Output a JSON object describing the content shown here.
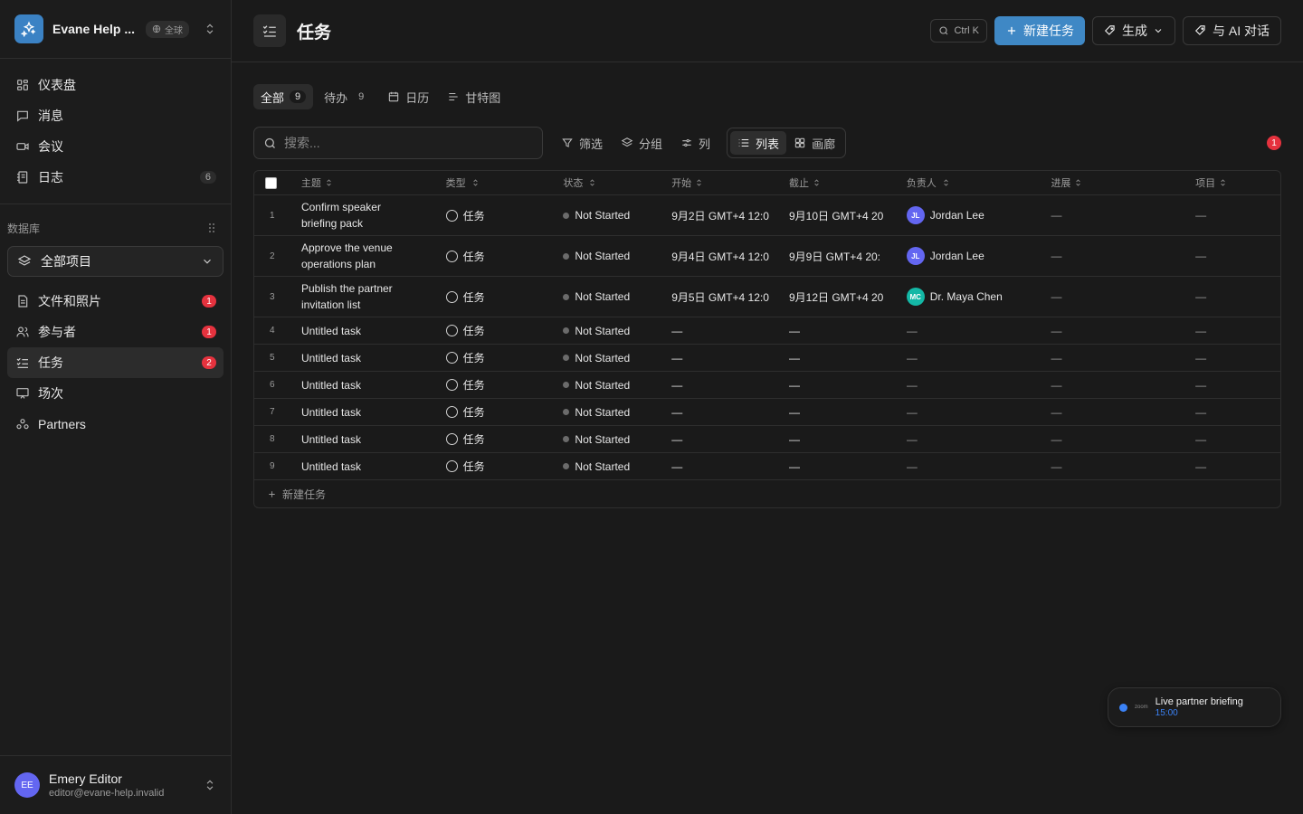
{
  "workspace": {
    "name": "Evane Help ...",
    "scope": "全球"
  },
  "nav": [
    {
      "id": "dashboard",
      "label": "仪表盘",
      "icon": "grid-icon"
    },
    {
      "id": "messages",
      "label": "消息",
      "icon": "message-icon"
    },
    {
      "id": "meetings",
      "label": "会议",
      "icon": "video-icon"
    },
    {
      "id": "logs",
      "label": "日志",
      "icon": "notebook-icon",
      "count": "6"
    }
  ],
  "database": {
    "header": "数据库",
    "selected": "全部项目",
    "items": [
      {
        "id": "files",
        "label": "文件和照片",
        "icon": "file-icon",
        "badge": "1"
      },
      {
        "id": "participants",
        "label": "参与者",
        "icon": "users-icon",
        "badge": "1"
      },
      {
        "id": "tasks",
        "label": "任务",
        "icon": "checklist-icon",
        "badge": "2",
        "active": true
      },
      {
        "id": "sessions",
        "label": "场次",
        "icon": "presentation-icon"
      },
      {
        "id": "partners",
        "label": "Partners",
        "icon": "partners-icon"
      }
    ]
  },
  "user": {
    "initials": "EE",
    "name": "Emery Editor",
    "email": "editor@evane-help.invalid"
  },
  "page": {
    "title": "任务"
  },
  "topbar": {
    "shortcut": "Ctrl K",
    "new_task": "新建任务",
    "generate": "生成",
    "ai_chat": "与 AI 对话"
  },
  "views": {
    "all_label": "全部",
    "all_count": "9",
    "todo_label": "待办",
    "todo_count": "9",
    "calendar_label": "日历",
    "gantt_label": "甘特图"
  },
  "toolbar": {
    "search_placeholder": "搜索...",
    "filter": "筛选",
    "group": "分组",
    "columns": "列",
    "list": "列表",
    "gallery": "画廊",
    "notifications": "1"
  },
  "table": {
    "headers": {
      "subject": "主题",
      "type": "类型",
      "status": "状态",
      "start": "开始",
      "due": "截止",
      "owner": "负责人",
      "progress": "进展",
      "project": "项目"
    },
    "rows": [
      {
        "num": "1",
        "subject": "Confirm speaker briefing pack",
        "type": "任务",
        "status": "Not Started",
        "start": "9月2日 GMT+4 12:0",
        "due": "9月10日 GMT+4 20",
        "owner": "Jordan Lee",
        "owner_initials": "JL",
        "owner_color": "#6366f1",
        "progress": "—",
        "project": "—"
      },
      {
        "num": "2",
        "subject": "Approve the venue operations plan",
        "type": "任务",
        "status": "Not Started",
        "start": "9月4日 GMT+4 12:0",
        "due": "9月9日 GMT+4 20:",
        "owner": "Jordan Lee",
        "owner_initials": "JL",
        "owner_color": "#6366f1",
        "progress": "—",
        "project": "—"
      },
      {
        "num": "3",
        "subject": "Publish the partner invitation list",
        "type": "任务",
        "status": "Not Started",
        "start": "9月5日 GMT+4 12:0",
        "due": "9月12日 GMT+4 20",
        "owner": "Dr. Maya Chen",
        "owner_initials": "MC",
        "owner_color": "#14b8a6",
        "progress": "—",
        "project": "—"
      },
      {
        "num": "4",
        "subject": "Untitled task",
        "type": "任务",
        "status": "Not Started",
        "start": "—",
        "due": "—",
        "owner": "—",
        "progress": "—",
        "project": "—"
      },
      {
        "num": "5",
        "subject": "Untitled task",
        "type": "任务",
        "status": "Not Started",
        "start": "—",
        "due": "—",
        "owner": "—",
        "progress": "—",
        "project": "—"
      },
      {
        "num": "6",
        "subject": "Untitled task",
        "type": "任务",
        "status": "Not Started",
        "start": "—",
        "due": "—",
        "owner": "—",
        "progress": "—",
        "project": "—"
      },
      {
        "num": "7",
        "subject": "Untitled task",
        "type": "任务",
        "status": "Not Started",
        "start": "—",
        "due": "—",
        "owner": "—",
        "progress": "—",
        "project": "—"
      },
      {
        "num": "8",
        "subject": "Untitled task",
        "type": "任务",
        "status": "Not Started",
        "start": "—",
        "due": "—",
        "owner": "—",
        "progress": "—",
        "project": "—"
      },
      {
        "num": "9",
        "subject": "Untitled task",
        "type": "任务",
        "status": "Not Started",
        "start": "—",
        "due": "—",
        "owner": "—",
        "progress": "—",
        "project": "—"
      }
    ],
    "add_row": "新建任务"
  },
  "meeting_toast": {
    "brand": "zoom",
    "title": "Live partner briefing",
    "time": "15:00"
  },
  "colors": {
    "accent": "#3f88c5",
    "badge_red": "#e5323e",
    "background": "#1a1a1a"
  }
}
